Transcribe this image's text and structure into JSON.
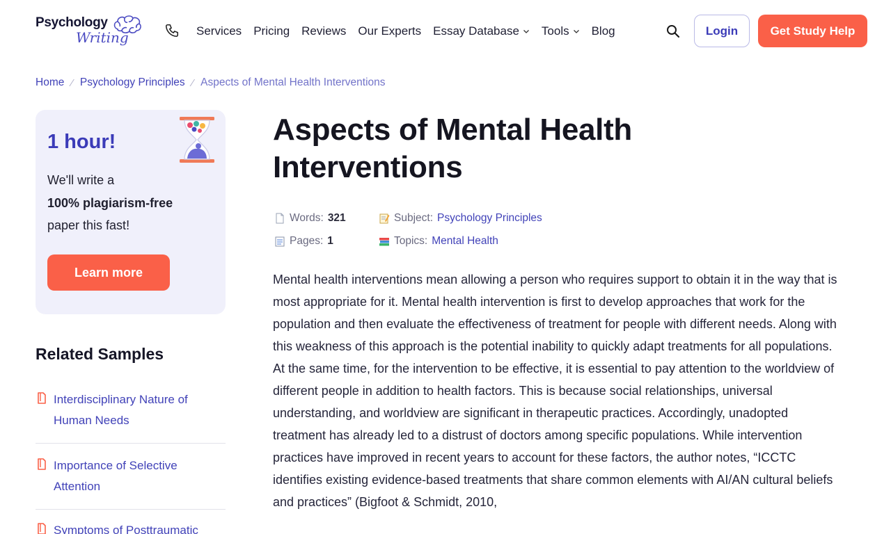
{
  "logo": {
    "line1": "Psychology",
    "line2": "Writing"
  },
  "nav": {
    "items": [
      {
        "label": "Services"
      },
      {
        "label": "Pricing"
      },
      {
        "label": "Reviews"
      },
      {
        "label": "Our Experts"
      },
      {
        "label": "Essay Database"
      },
      {
        "label": "Tools"
      },
      {
        "label": "Blog"
      }
    ],
    "login_label": "Login",
    "help_label": "Get Study Help"
  },
  "breadcrumb": {
    "home": "Home",
    "category": "Psychology Principles",
    "current": "Aspects of Mental Health Interventions"
  },
  "promo": {
    "title": "1 hour!",
    "line1": "We'll write a",
    "line2": "100% plagiarism-free",
    "line3": "paper this fast!",
    "button": "Learn more"
  },
  "related": {
    "title": "Related Samples",
    "items": [
      {
        "label": "Interdisciplinary Nature of Human Needs"
      },
      {
        "label": "Importance of Selective Attention"
      },
      {
        "label": "Symptoms of Posttraumatic"
      }
    ]
  },
  "article": {
    "title": "Aspects of Mental Health Interventions",
    "meta": {
      "words_label": "Words:",
      "words_value": "321",
      "pages_label": "Pages:",
      "pages_value": "1",
      "subject_label": "Subject:",
      "subject_value": "Psychology Principles",
      "topics_label": "Topics:",
      "topics_value": "Mental Health"
    },
    "body": "Mental health interventions mean allowing a person who requires support to obtain it in the way that is most appropriate for it. Mental health intervention is first to develop approaches that work for the population and then evaluate the effectiveness of treatment for people with different needs. Along with this weakness of this approach is the potential inability to quickly adapt treatments for all populations. At the same time, for the intervention to be effective, it is essential to pay attention to the worldview of different people in addition to health factors. This is because social relationships, universal understanding, and worldview are significant in therapeutic practices. Accordingly, unadopted treatment has already led to a distrust of doctors among specific populations. While intervention practices have improved in recent years to account for these factors, the author notes, “ICCTC identifies existing evidence-based treatments that share common elements with AI/AN cultural beliefs and practices” (Bigfoot & Schmidt, 2010,"
  },
  "colors": {
    "accent": "#3b3bb8",
    "cta": "#fa6048",
    "card_bg": "#f0f0fb"
  }
}
